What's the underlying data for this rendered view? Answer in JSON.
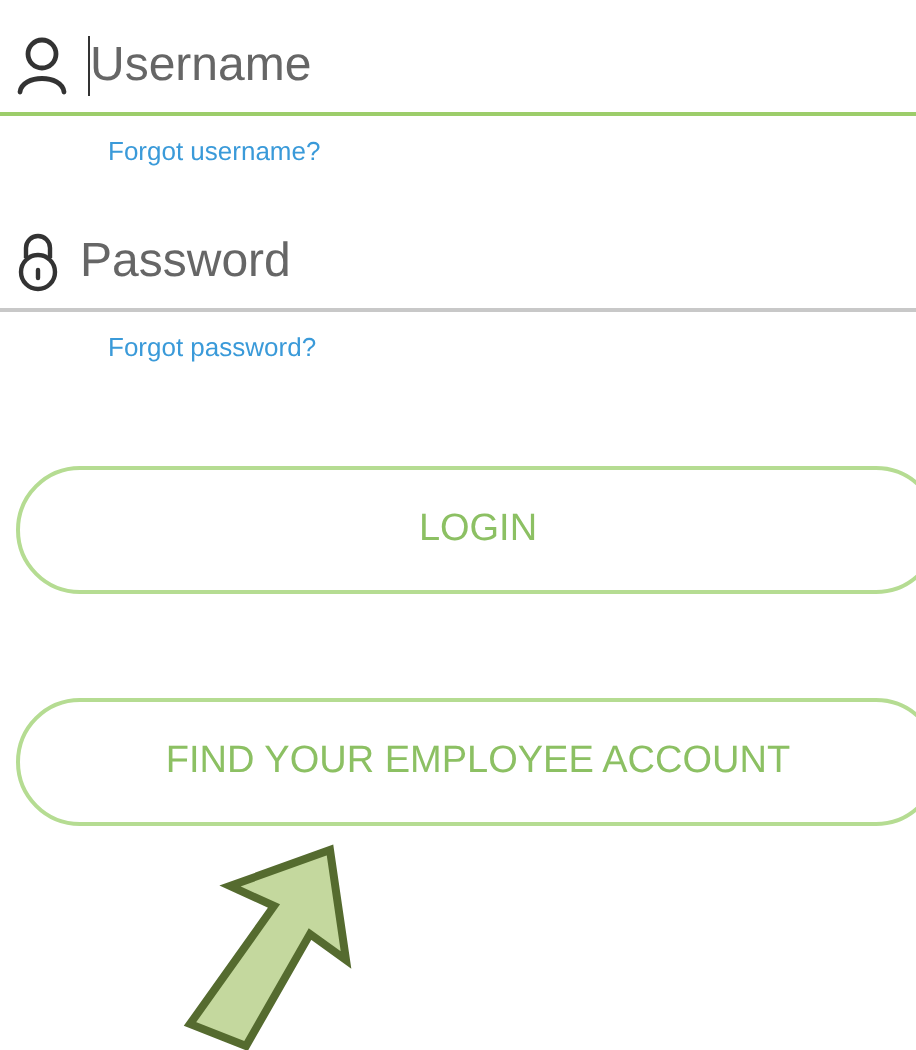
{
  "fields": [
    {
      "kind": "text",
      "placeholder": "Username",
      "focused": true,
      "link": "Forgot username?"
    },
    {
      "kind": "password",
      "placeholder": "Password",
      "focused": false,
      "link": "Forgot password?"
    }
  ],
  "buttons": [
    "LOGIN",
    "FIND YOUR EMPLOYEE ACCOUNT"
  ]
}
